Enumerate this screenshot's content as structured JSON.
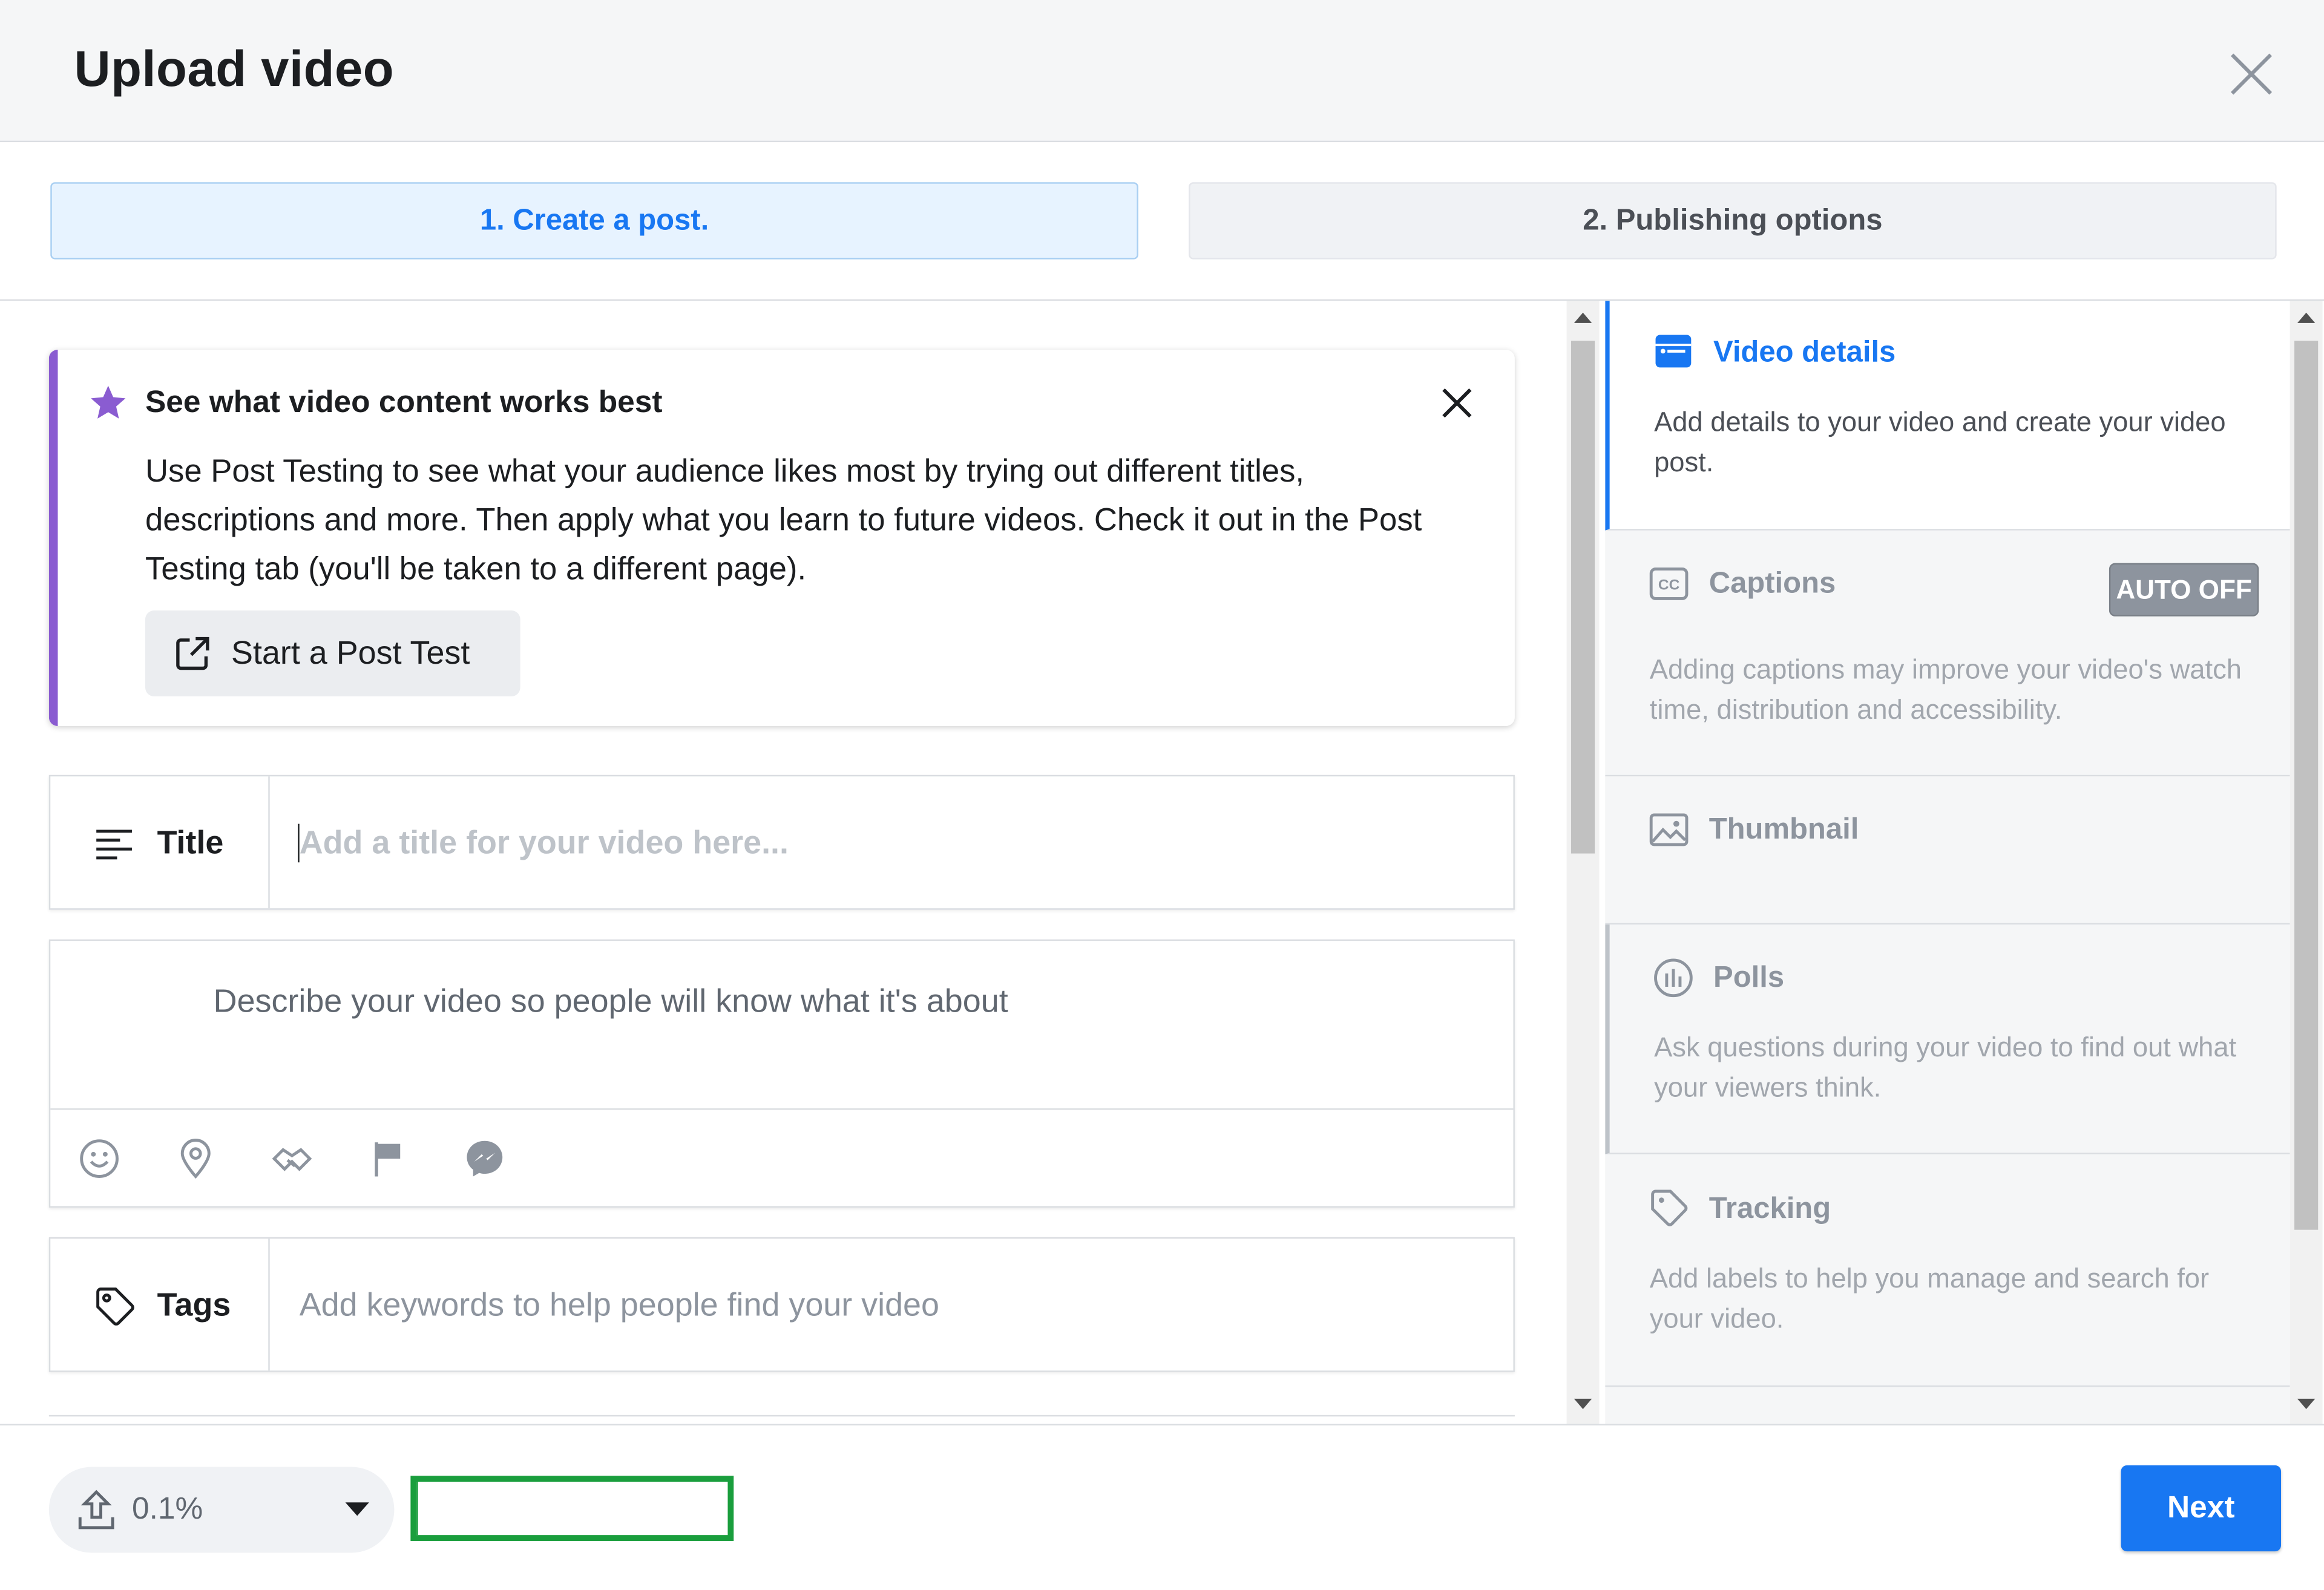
{
  "dialog": {
    "title": "Upload video"
  },
  "steps": [
    {
      "label": "1. Create a post.",
      "active": true
    },
    {
      "label": "2. Publishing options",
      "active": false
    }
  ],
  "tip": {
    "title": "See what video content works best",
    "body": "Use Post Testing to see what your audience likes most by trying out different titles, descriptions and more. Then apply what you learn to future videos. Check it out in the Post Testing tab (you'll be taken to a different page).",
    "button_label": "Start a Post Test"
  },
  "title_field": {
    "label": "Title",
    "value": "",
    "placeholder": "Add a title for your video here..."
  },
  "description_field": {
    "value": "",
    "placeholder": "Describe your video so people will know what it's about"
  },
  "tags_field": {
    "label": "Tags",
    "value": "",
    "placeholder": "Add keywords to help people find your video"
  },
  "sidebar": {
    "sections": [
      {
        "title": "Video details",
        "description": "Add details to your video and create your video post.",
        "icon": "video-details-icon",
        "active": true
      },
      {
        "title": "Captions",
        "description": "Adding captions may improve your video's watch time, distribution and accessibility.",
        "icon": "captions-cc-icon",
        "badge": "AUTO OFF"
      },
      {
        "title": "Thumbnail",
        "description": "",
        "icon": "image-icon"
      },
      {
        "title": "Polls",
        "description": "Ask questions during your video to find out what your viewers think.",
        "icon": "polls-icon"
      },
      {
        "title": "Tracking",
        "description": "Add labels to help you manage and search for your video.",
        "icon": "tag-icon"
      }
    ]
  },
  "footer": {
    "upload_progress": "0.1%",
    "upload_fraction": 0.001,
    "next_label": "Next"
  },
  "colors": {
    "accent": "#1877f2",
    "tip_border": "#8a5cd1",
    "progress": "#1a9e3d"
  }
}
